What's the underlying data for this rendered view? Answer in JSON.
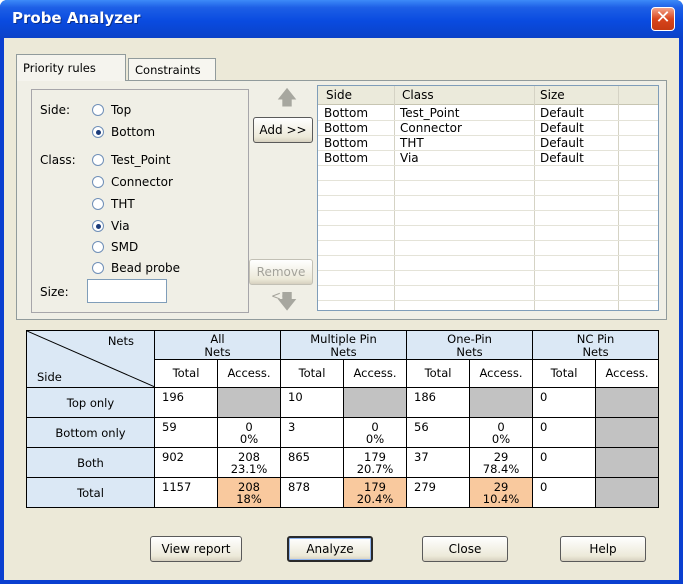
{
  "window": {
    "title": "Probe Analyzer"
  },
  "tabs": [
    {
      "label": "Priority rules",
      "active": true
    },
    {
      "label": "Constraints",
      "active": false
    }
  ],
  "form": {
    "side_label": "Side:",
    "side_options": [
      {
        "label": "Top",
        "checked": false
      },
      {
        "label": "Bottom",
        "checked": true
      }
    ],
    "class_label": "Class:",
    "class_options": [
      {
        "label": "Test_Point",
        "checked": false
      },
      {
        "label": "Connector",
        "checked": false
      },
      {
        "label": "THT",
        "checked": false
      },
      {
        "label": "Via",
        "checked": true
      },
      {
        "label": "SMD",
        "checked": false
      },
      {
        "label": "Bead probe",
        "checked": false
      }
    ],
    "size_label": "Size:",
    "size_value": ""
  },
  "buttons": {
    "add": "Add >>",
    "remove": "Remove <<",
    "view_report": "View report",
    "analyze": "Analyze",
    "close": "Close",
    "help": "Help"
  },
  "rules_list": {
    "columns": [
      "Side",
      "Class",
      "Size"
    ],
    "rows": [
      [
        "Bottom",
        "Test_Point",
        "Default"
      ],
      [
        "Bottom",
        "Connector",
        "Default"
      ],
      [
        "Bottom",
        "THT",
        "Default"
      ],
      [
        "Bottom",
        "Via",
        "Default"
      ]
    ]
  },
  "stats": {
    "corner_top": "Nets",
    "corner_bottom": "Side",
    "groups": [
      "All\nNets",
      "Multiple Pin\nNets",
      "One-Pin\nNets",
      "NC Pin\nNets"
    ],
    "sub_total": "Total",
    "sub_access": "Access.",
    "rows": [
      {
        "label": "Top only",
        "cells": [
          [
            "196",
            ""
          ],
          [
            "10",
            ""
          ],
          [
            "186",
            ""
          ],
          [
            "0",
            ""
          ]
        ]
      },
      {
        "label": "Bottom only",
        "cells": [
          [
            "59",
            "0\n0%"
          ],
          [
            "3",
            "0\n0%"
          ],
          [
            "56",
            "0\n0%"
          ],
          [
            "0",
            ""
          ]
        ]
      },
      {
        "label": "Both",
        "cells": [
          [
            "902",
            "208\n23.1%"
          ],
          [
            "865",
            "179\n20.7%"
          ],
          [
            "37",
            "29\n78.4%"
          ],
          [
            "0",
            ""
          ]
        ]
      },
      {
        "label": "Total",
        "cells": [
          [
            "1157",
            "208\n18%"
          ],
          [
            "878",
            "179\n20.4%"
          ],
          [
            "279",
            "29\n10.4%"
          ],
          [
            "0",
            ""
          ]
        ]
      }
    ]
  }
}
